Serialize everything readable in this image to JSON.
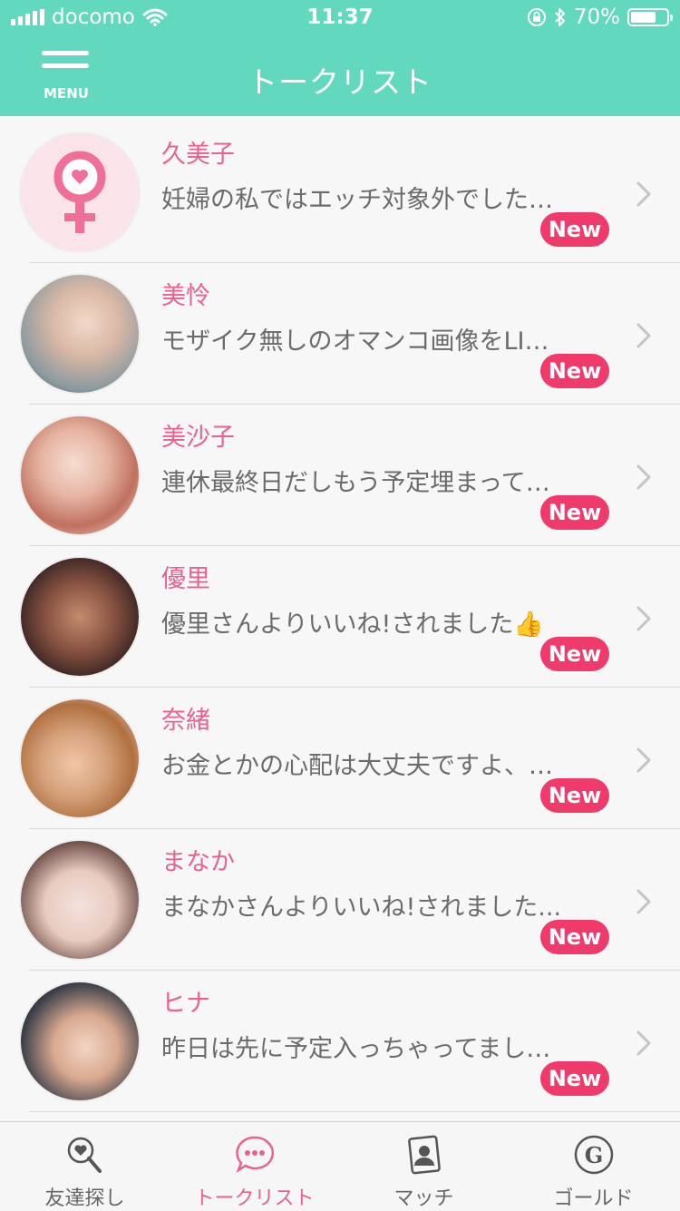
{
  "status": {
    "carrier": "docomo",
    "time": "11:37",
    "battery": "70%",
    "battery_level": 0.7
  },
  "header": {
    "menu_label": "MENU",
    "title": "トークリスト"
  },
  "badge_label": "New",
  "talks": [
    {
      "name": "久美子",
      "message": "妊婦の私ではエッチ対象外でした…",
      "avatar": "female-symbol-icon"
    },
    {
      "name": "美怜",
      "message": "モザイク無しのオマンコ画像をLI…",
      "avatar": "user-photo"
    },
    {
      "name": "美沙子",
      "message": "連休最終日だしもう予定埋まって…",
      "avatar": "user-photo"
    },
    {
      "name": "優里",
      "message": "優里さんよりいいね!されました👍",
      "avatar": "user-photo"
    },
    {
      "name": "奈緒",
      "message": "お金とかの心配は大丈夫ですよ、…",
      "avatar": "user-photo"
    },
    {
      "name": "まなか",
      "message": "まなかさんよりいいね!されました...",
      "avatar": "user-photo"
    },
    {
      "name": "ヒナ",
      "message": "昨日は先に予定入っちゃってまし…",
      "avatar": "user-photo"
    }
  ],
  "tabs": [
    {
      "label": "友達探し",
      "icon": "heart-search-icon"
    },
    {
      "label": "トークリスト",
      "icon": "chat-bubble-icon",
      "active": true
    },
    {
      "label": "マッチ",
      "icon": "profile-card-icon"
    },
    {
      "label": "ゴールド",
      "icon": "gold-coin-icon"
    }
  ],
  "colors": {
    "header": "#62d9bf",
    "accent_pink": "#e8628f",
    "badge": "#f03a6c"
  }
}
